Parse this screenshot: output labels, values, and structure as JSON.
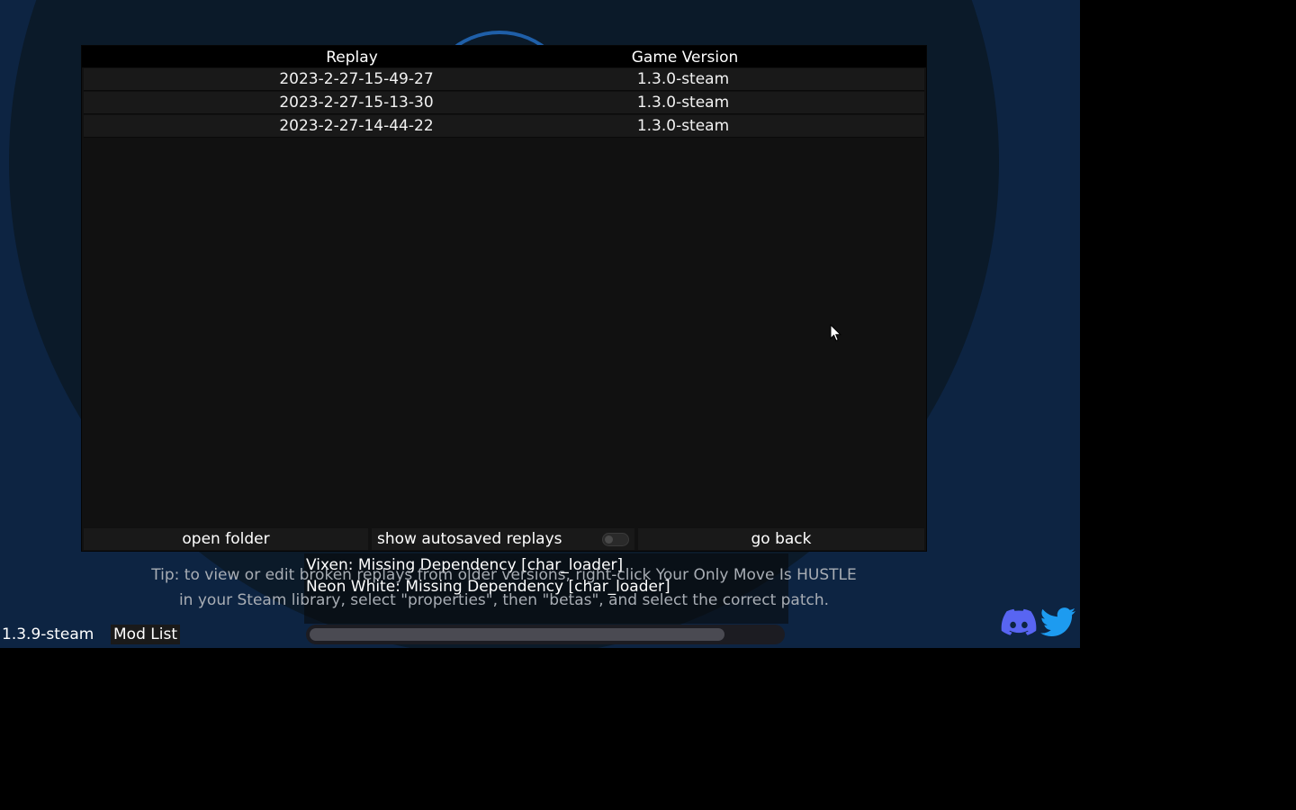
{
  "replays": {
    "headers": {
      "replay": "Replay",
      "version": "Game Version"
    },
    "rows": [
      {
        "name": "2023-2-27-15-49-27",
        "version": "1.3.0-steam"
      },
      {
        "name": "2023-2-27-15-13-30",
        "version": "1.3.0-steam"
      },
      {
        "name": "2023-2-27-14-44-22",
        "version": "1.3.0-steam"
      }
    ],
    "buttons": {
      "open_folder": "open folder",
      "show_autosaved": "show autosaved replays",
      "go_back": "go back"
    },
    "autosave_enabled": false
  },
  "tip": {
    "line1": "Tip: to view or edit broken replays from older versions, right-click Your Only Move Is HUSTLE",
    "line2": "in your Steam library, select \"properties\", then \"betas\", and select the correct patch."
  },
  "missing_deps": [
    "Vixen: Missing Dependency [char_loader]",
    "Neon White: Missing Dependency [char_loader]"
  ],
  "footer": {
    "version": "1.3.9-steam",
    "mod_list": "Mod List"
  },
  "scroll": {
    "position": 0.88
  },
  "colors": {
    "background": "#0d2442",
    "panel": "#111111",
    "discord": "#5865f2",
    "twitter": "#1d9bf0"
  },
  "icons": [
    "discord-icon",
    "twitter-icon",
    "cursor-icon"
  ]
}
